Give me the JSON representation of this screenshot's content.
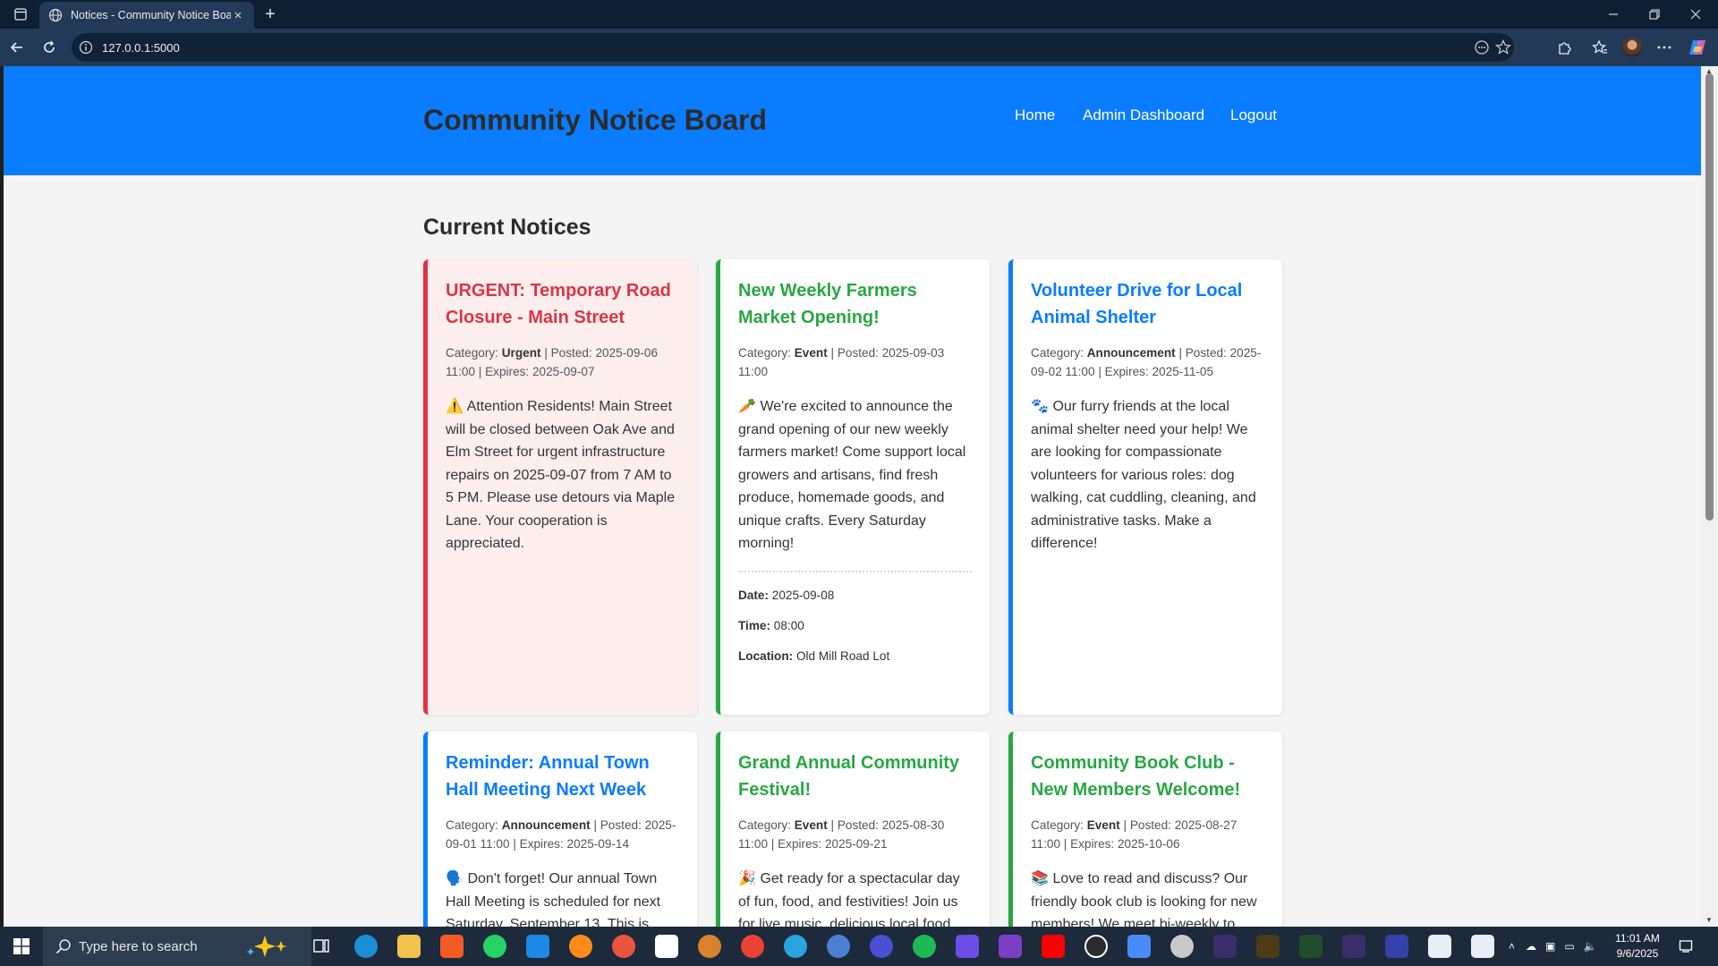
{
  "browser": {
    "tab_title": "Notices - Community Notice Board",
    "url": "127.0.0.1:5000"
  },
  "site": {
    "title": "Community Notice Board",
    "nav": [
      "Home",
      "Admin Dashboard",
      "Logout"
    ],
    "section_title": "Current Notices",
    "colors": {
      "header": "#0a7cff",
      "urgent": "#dc3545",
      "event": "#28a745",
      "announcement": "#0a7cff"
    }
  },
  "notices": [
    {
      "title": "URGENT: Temporary Road Closure - Main Street",
      "meta_category_label": "Category:",
      "category": "Urgent",
      "meta_rest": "| Posted: 2025-09-06 11:00 | Expires: 2025-09-07",
      "emoji": "⚠️",
      "body": "Attention Residents! Main Street will be closed between Oak Ave and Elm Street for urgent infrastructure repairs on 2025-09-07 from 7 AM to 5 PM. Please use detours via Maple Lane. Your cooperation is appreciated."
    },
    {
      "title": "New Weekly Farmers Market Opening!",
      "meta_category_label": "Category:",
      "category": "Event",
      "meta_rest": "| Posted: 2025-09-03 11:00",
      "emoji": "🥕",
      "body": "We're excited to announce the grand opening of our new weekly farmers market! Come support local growers and artisans, find fresh produce, homemade goods, and unique crafts. Every Saturday morning!",
      "date_label": "Date:",
      "date": "2025-09-08",
      "time_label": "Time:",
      "time": "08:00",
      "location_label": "Location:",
      "location": "Old Mill Road Lot"
    },
    {
      "title": "Volunteer Drive for Local Animal Shelter",
      "meta_category_label": "Category:",
      "category": "Announcement",
      "meta_rest": "| Posted: 2025-09-02 11:00 | Expires: 2025-11-05",
      "emoji": "🐾",
      "body": "Our furry friends at the local animal shelter need your help! We are looking for compassionate volunteers for various roles: dog walking, cat cuddling, cleaning, and administrative tasks. Make a difference!"
    },
    {
      "title": "Reminder: Annual Town Hall Meeting Next Week",
      "meta_category_label": "Category:",
      "category": "Announcement",
      "meta_rest": "| Posted: 2025-09-01 11:00 | Expires: 2025-09-14",
      "emoji": "🗣️",
      "body": "Don't forget! Our annual Town Hall Meeting is scheduled for next Saturday, September 13. This is"
    },
    {
      "title": "Grand Annual Community Festival!",
      "meta_category_label": "Category:",
      "category": "Event",
      "meta_rest": "| Posted: 2025-08-30 11:00 | Expires: 2025-09-21",
      "emoji": "🎉",
      "body": "Get ready for a spectacular day of fun, food, and festivities! Join us for live music, delicious local food"
    },
    {
      "title": "Community Book Club - New Members Welcome!",
      "meta_category_label": "Category:",
      "category": "Event",
      "meta_rest": "| Posted: 2025-08-27 11:00 | Expires: 2025-10-06",
      "emoji": "📚",
      "body": "Love to read and discuss? Our friendly book club is looking for new members! We meet bi-weekly to"
    }
  ],
  "taskbar": {
    "search_placeholder": "Type here to search",
    "time": "11:01 AM",
    "date": "9/6/2025"
  }
}
